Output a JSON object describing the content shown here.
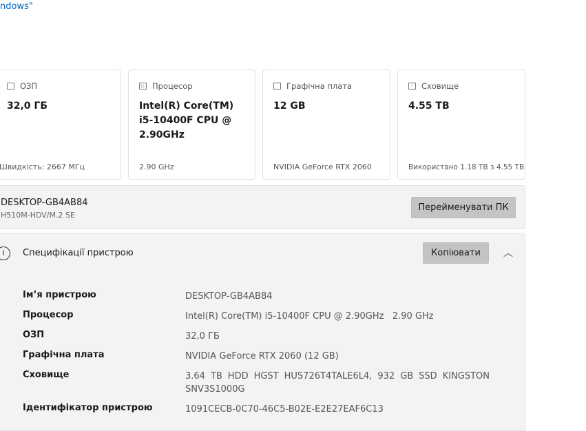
{
  "top_link": "ndows\"",
  "cards": [
    {
      "icon": "ram-icon",
      "label": "ОЗП",
      "value": "32,0 ГБ",
      "footer": "Швидкість: 2667 МГц"
    },
    {
      "icon": "cpu-icon",
      "label": "Процесор",
      "value": "Intel(R) Core(TM) i5-10400F CPU @ 2.90GHz",
      "footer": "2.90 GHz"
    },
    {
      "icon": "gpu-icon",
      "label": "Графічна плата",
      "value": "12 GB",
      "footer": "NVIDIA GeForce RTX 2060"
    },
    {
      "icon": "storage-icon",
      "label": "Сховище",
      "value": "4.55 TB",
      "footer": "Використано 1.18 TB з 4.55 TB"
    }
  ],
  "device": {
    "name": "DESKTOP-GB4AB84",
    "model": "H510M-HDV/M.2 SE",
    "rename_label": "Перейменувати ПК"
  },
  "specs": {
    "title": "Специфікації пристрою",
    "copy_label": "Копіювати",
    "rows": [
      {
        "key": "Ім’я пристрою",
        "value": "DESKTOP-GB4AB84"
      },
      {
        "key": "Процесор",
        "value": "Intel(R) Core(TM) i5-10400F CPU @ 2.90GHz   2.90 GHz"
      },
      {
        "key": "ОЗП",
        "value": "32,0 ГБ"
      },
      {
        "key": "Графічна плата",
        "value": "NVIDIA GeForce RTX 2060 (12 GB)"
      },
      {
        "key": "Сховище",
        "value": "3.64 TB HDD HGST HUS726T4TALE6L4, 932 GB SSD KINGSTON SNV3S1000G"
      },
      {
        "key": "Ідентифікатор пристрою",
        "value": "1091CECB-0C70-46C5-B02E-E2E27EAF6C13"
      }
    ]
  }
}
